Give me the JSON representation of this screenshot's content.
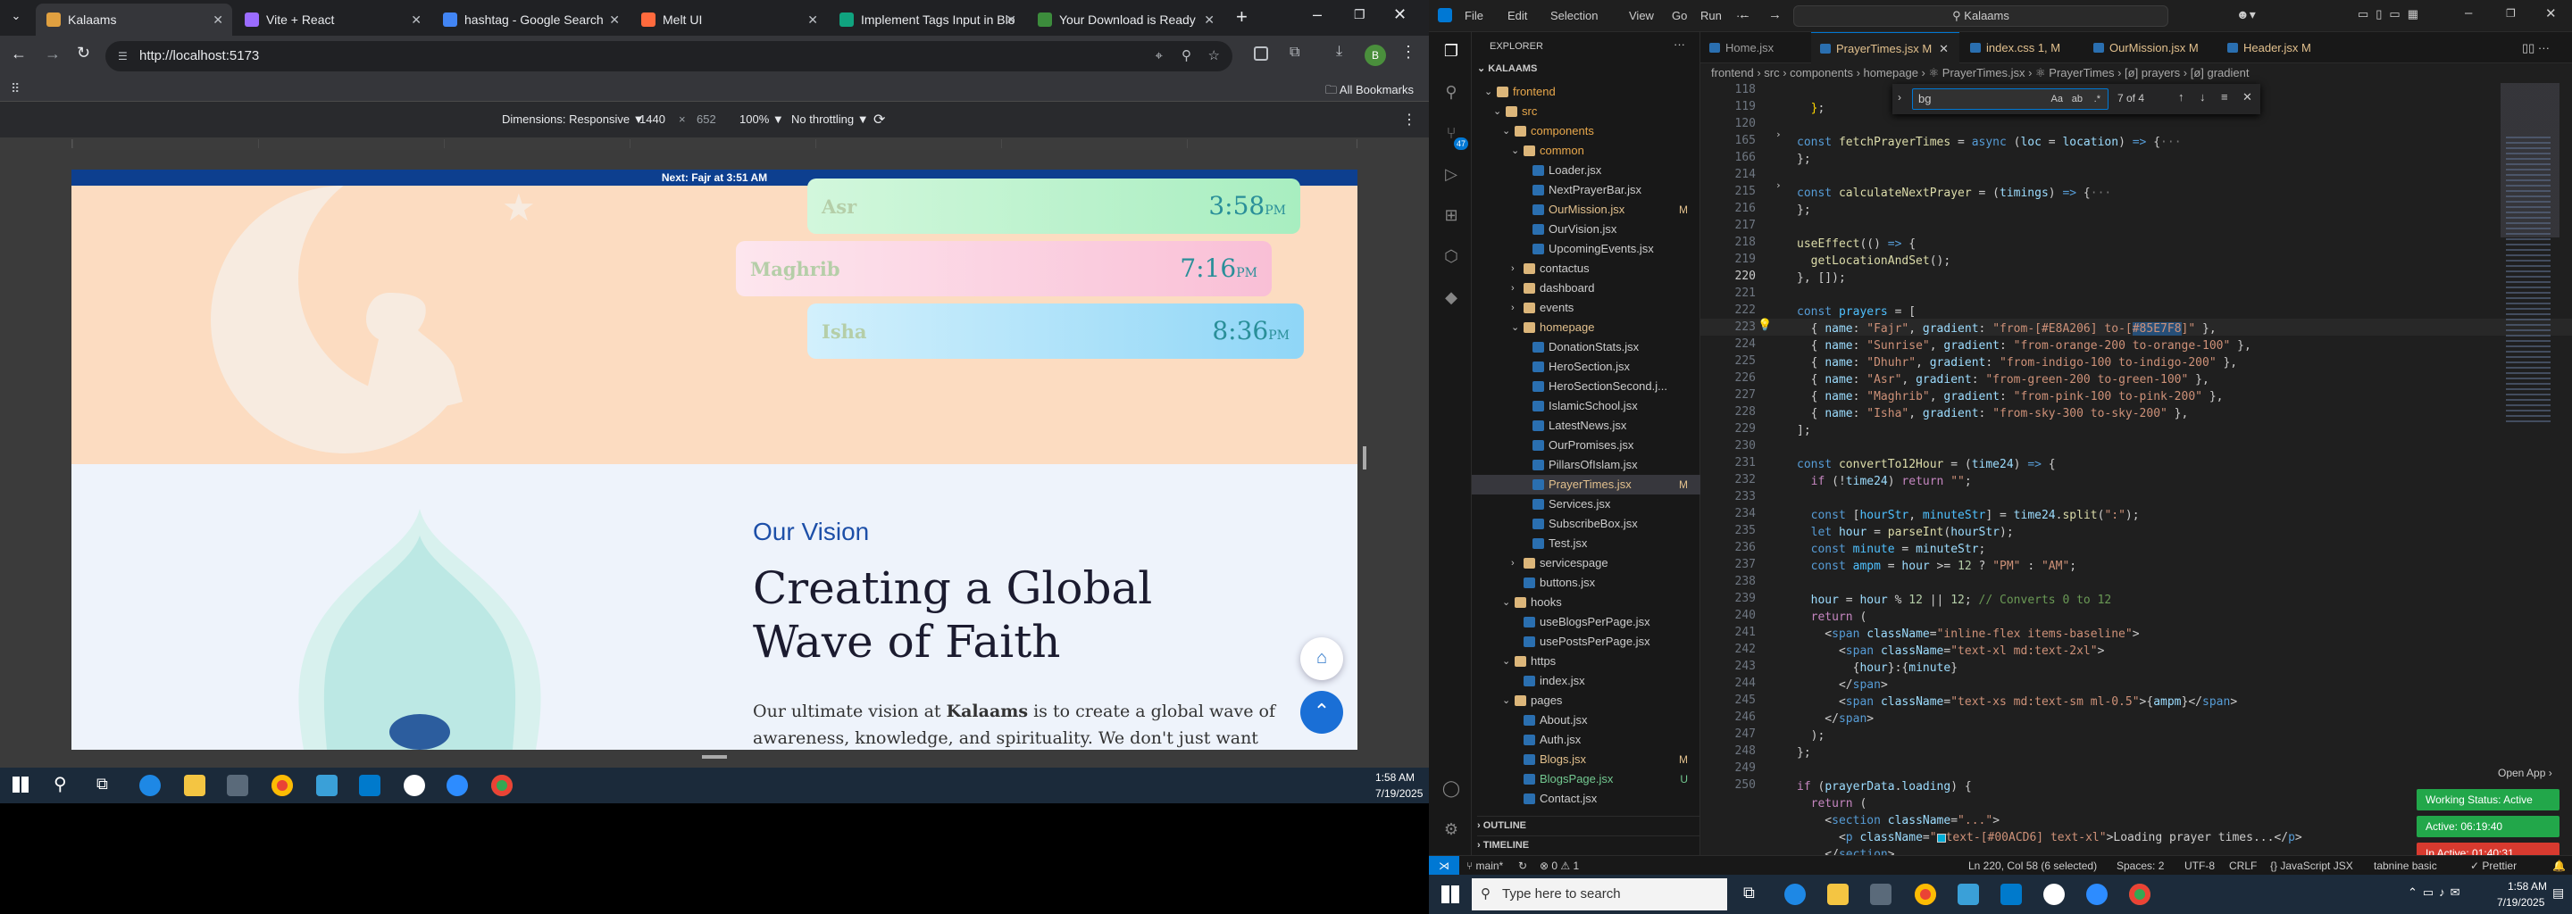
{
  "browser": {
    "tabs": [
      {
        "title": "Kalaams",
        "color": "#e0a040"
      },
      {
        "title": "Vite + React",
        "color": "#9b6cff"
      },
      {
        "title": "hashtag - Google Search",
        "color": "#4285f4"
      },
      {
        "title": "Melt UI",
        "color": "#ff6a3d"
      },
      {
        "title": "Implement Tags Input in Blo",
        "color": "#10a37f"
      },
      {
        "title": "Your Download is Ready",
        "color": "#3c8c3c"
      }
    ],
    "url": "http://localhost:5173",
    "all_bookmarks": "All Bookmarks",
    "devtools": {
      "dimensions_label": "Dimensions: Responsive ▼",
      "width": "1440",
      "x": "×",
      "height": "652",
      "zoom": "100% ▼",
      "throttle": "No throttling ▼"
    }
  },
  "site": {
    "next_prayer": "Next: Fajr at 3:51 AM",
    "prayers": [
      {
        "name": "Asr",
        "time": "3:58",
        "ampm": "PM"
      },
      {
        "name": "Maghrib",
        "time": "7:16",
        "ampm": "PM"
      },
      {
        "name": "Isha",
        "time": "8:36",
        "ampm": "PM"
      }
    ],
    "vision_eyebrow": "Our Vision",
    "vision_title_1": "Creating a Global",
    "vision_title_2": "Wave of Faith",
    "vision_body_1": "Our ultimate vision at ",
    "vision_body_brand": "Kalaams",
    "vision_body_2": " is to create a global wave of",
    "vision_body_3": "awareness, knowledge, and spirituality. We don't just want"
  },
  "left_taskbar": {
    "time": "1:58 AM",
    "date": "7/19/2025"
  },
  "vscode": {
    "menu": [
      "File",
      "Edit",
      "Selection",
      "View",
      "Go",
      "Run",
      "···"
    ],
    "search": "Kalaams",
    "explorer_title": "EXPLORER",
    "workspace": "KALAAMS",
    "tree": [
      {
        "label": "frontend",
        "depth": 1,
        "type": "folder",
        "open": true,
        "status": "",
        "color": "#e8a84c"
      },
      {
        "label": "src",
        "depth": 2,
        "type": "folder",
        "open": true,
        "status": "",
        "color": "#e8a84c"
      },
      {
        "label": "components",
        "depth": 3,
        "type": "folder",
        "open": true,
        "status": "",
        "color": "#e8a84c"
      },
      {
        "label": "common",
        "depth": 4,
        "type": "folder",
        "open": true,
        "status": "",
        "color": "#e8a84c"
      },
      {
        "label": "Loader.jsx",
        "depth": 5,
        "type": "file",
        "status": "",
        "color": "#cccccc"
      },
      {
        "label": "NextPrayerBar.jsx",
        "depth": 5,
        "type": "file",
        "status": "",
        "color": "#cccccc"
      },
      {
        "label": "OurMission.jsx",
        "depth": 5,
        "type": "file",
        "status": "M",
        "color": "#e2c08d"
      },
      {
        "label": "OurVision.jsx",
        "depth": 5,
        "type": "file",
        "status": "",
        "color": "#cccccc"
      },
      {
        "label": "UpcomingEvents.jsx",
        "depth": 5,
        "type": "file",
        "status": "",
        "color": "#cccccc"
      },
      {
        "label": "contactus",
        "depth": 4,
        "type": "folder",
        "open": false,
        "status": "",
        "color": "#cccccc"
      },
      {
        "label": "dashboard",
        "depth": 4,
        "type": "folder",
        "open": false,
        "status": "",
        "color": "#cccccc"
      },
      {
        "label": "events",
        "depth": 4,
        "type": "folder",
        "open": false,
        "status": "",
        "color": "#cccccc"
      },
      {
        "label": "homepage",
        "depth": 4,
        "type": "folder",
        "open": true,
        "status": "",
        "color": "#e2c08d"
      },
      {
        "label": "DonationStats.jsx",
        "depth": 5,
        "type": "file",
        "status": "",
        "color": "#cccccc"
      },
      {
        "label": "HeroSection.jsx",
        "depth": 5,
        "type": "file",
        "status": "",
        "color": "#cccccc"
      },
      {
        "label": "HeroSectionSecond.j...",
        "depth": 5,
        "type": "file",
        "status": "",
        "color": "#cccccc"
      },
      {
        "label": "IslamicSchool.jsx",
        "depth": 5,
        "type": "file",
        "status": "",
        "color": "#cccccc"
      },
      {
        "label": "LatestNews.jsx",
        "depth": 5,
        "type": "file",
        "status": "",
        "color": "#cccccc"
      },
      {
        "label": "OurPromises.jsx",
        "depth": 5,
        "type": "file",
        "status": "",
        "color": "#cccccc"
      },
      {
        "label": "PillarsOfIslam.jsx",
        "depth": 5,
        "type": "file",
        "status": "",
        "color": "#cccccc"
      },
      {
        "label": "PrayerTimes.jsx",
        "depth": 5,
        "type": "file",
        "status": "M",
        "color": "#e2c08d",
        "selected": true
      },
      {
        "label": "Services.jsx",
        "depth": 5,
        "type": "file",
        "status": "",
        "color": "#cccccc"
      },
      {
        "label": "SubscribeBox.jsx",
        "depth": 5,
        "type": "file",
        "status": "",
        "color": "#cccccc"
      },
      {
        "label": "Test.jsx",
        "depth": 5,
        "type": "file",
        "status": "",
        "color": "#cccccc"
      },
      {
        "label": "servicespage",
        "depth": 4,
        "type": "folder",
        "open": false,
        "status": "",
        "color": "#cccccc"
      },
      {
        "label": "buttons.jsx",
        "depth": 4,
        "type": "file",
        "status": "",
        "color": "#cccccc"
      },
      {
        "label": "hooks",
        "depth": 3,
        "type": "folder",
        "open": true,
        "status": "",
        "color": "#cccccc"
      },
      {
        "label": "useBlogsPerPage.jsx",
        "depth": 4,
        "type": "file",
        "status": "",
        "color": "#cccccc"
      },
      {
        "label": "usePostsPerPage.jsx",
        "depth": 4,
        "type": "file",
        "status": "",
        "color": "#cccccc"
      },
      {
        "label": "https",
        "depth": 3,
        "type": "folder",
        "open": true,
        "status": "",
        "color": "#cccccc"
      },
      {
        "label": "index.jsx",
        "depth": 4,
        "type": "file",
        "status": "",
        "color": "#cccccc"
      },
      {
        "label": "pages",
        "depth": 3,
        "type": "folder",
        "open": true,
        "status": "",
        "color": "#cccccc"
      },
      {
        "label": "About.jsx",
        "depth": 4,
        "type": "file",
        "status": "",
        "color": "#cccccc"
      },
      {
        "label": "Auth.jsx",
        "depth": 4,
        "type": "file",
        "status": "",
        "color": "#cccccc"
      },
      {
        "label": "Blogs.jsx",
        "depth": 4,
        "type": "file",
        "status": "M",
        "color": "#e2c08d"
      },
      {
        "label": "BlogsPage.jsx",
        "depth": 4,
        "type": "file",
        "status": "U",
        "color": "#73c991"
      },
      {
        "label": "Contact.jsx",
        "depth": 4,
        "type": "file",
        "status": "",
        "color": "#cccccc"
      }
    ],
    "outline": "OUTLINE",
    "timeline": "TIMELINE",
    "tabs": [
      {
        "label": "Home.jsx",
        "status": "",
        "color": "#9d9d9d"
      },
      {
        "label": "PrayerTimes.jsx",
        "status": "M",
        "color": "#e2c08d",
        "active": true
      },
      {
        "label": "index.css",
        "status": "1, M",
        "color": "#e2c08d"
      },
      {
        "label": "OurMission.jsx",
        "status": "M",
        "color": "#e2c08d"
      },
      {
        "label": "Header.jsx",
        "status": "M",
        "color": "#e2c08d"
      }
    ],
    "breadcrumb": "frontend › src › components › homepage › ⚛ PrayerTimes.jsx › ⚛ PrayerTimes › [ø] prayers › [ø] gradient",
    "find": {
      "query": "bg",
      "count": "7 of 4"
    },
    "line_numbers": [
      "118",
      "119",
      "120",
      "165",
      "166",
      "214",
      "215",
      "216",
      "217",
      "218",
      "219",
      "220",
      "221",
      "222",
      "223",
      "224",
      "225",
      "226",
      "227",
      "228",
      "229",
      "230",
      "231",
      "232",
      "233",
      "234",
      "235",
      "236",
      "237",
      "238",
      "239",
      "240",
      "241",
      "242",
      "243",
      "244",
      "245",
      "246",
      "247",
      "248",
      "249",
      "250"
    ],
    "current_line": "220",
    "status_bar": {
      "branch": "main*",
      "problems": "⊗ 0 ⚠ 1",
      "position": "Ln 220, Col 58 (6 selected)",
      "spaces": "Spaces: 2",
      "encoding": "UTF-8",
      "eol": "CRLF",
      "language": "{} JavaScript JSX",
      "ext": "tabnine basic",
      "prettier": "✓ Prettier"
    },
    "open_app": "Open App ›",
    "badges": [
      {
        "label": "Working Status: Active",
        "color": "#22a74a"
      },
      {
        "label": "Active: 06:19:40",
        "color": "#22a74a"
      },
      {
        "label": "In Active: 01:40:31",
        "color": "#d83a2f"
      }
    ]
  },
  "right_taskbar": {
    "search": "Type here to search",
    "time": "1:58 AM",
    "date": "7/19/2025"
  }
}
